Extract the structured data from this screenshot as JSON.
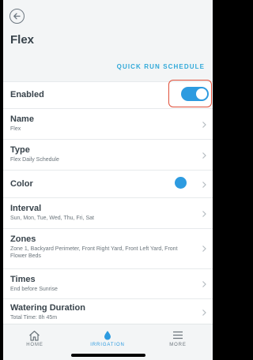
{
  "header": {
    "title": "Flex",
    "quick_run_label": "QUICK RUN SCHEDULE"
  },
  "settings": {
    "enabled": {
      "label": "Enabled",
      "value": true
    },
    "name": {
      "label": "Name",
      "value": "Flex"
    },
    "type": {
      "label": "Type",
      "value": "Flex Daily Schedule"
    },
    "color": {
      "label": "Color",
      "value": "#2d9be0"
    },
    "interval": {
      "label": "Interval",
      "value": "Sun, Mon, Tue, Wed, Thu, Fri, Sat"
    },
    "zones": {
      "label": "Zones",
      "value": "Zone 1, Backyard Perimeter, Front Right Yard, Front Left Yard, Front Flower Beds"
    },
    "times": {
      "label": "Times",
      "value": "End before Sunrise"
    },
    "duration": {
      "label": "Watering Duration",
      "value": "Total Time: 8h 45m"
    }
  },
  "tabs": [
    {
      "label": "HOME",
      "icon": "home-icon",
      "active": false
    },
    {
      "label": "IRRIGATION",
      "icon": "water-drop-icon",
      "active": true
    },
    {
      "label": "MORE",
      "icon": "menu-icon",
      "active": false
    }
  ],
  "colors": {
    "accent": "#2d9be0",
    "link": "#31a9d9",
    "highlight_box": "#e0503b"
  }
}
